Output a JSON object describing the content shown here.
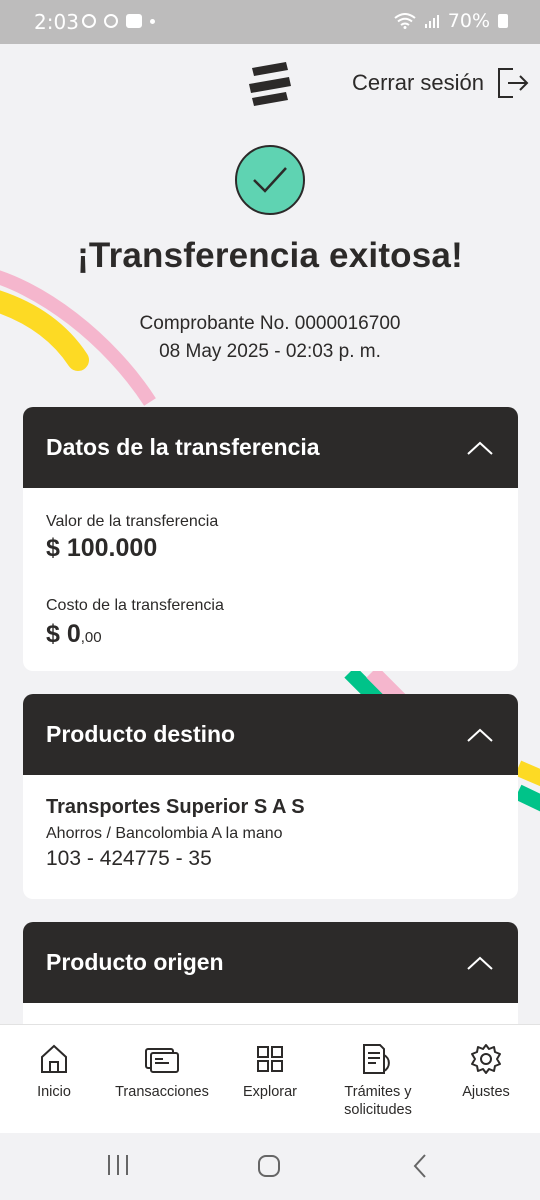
{
  "status_bar": {
    "time": "2:03",
    "battery": "70%"
  },
  "header": {
    "logout_label": "Cerrar sesión"
  },
  "success": {
    "title": "¡Transferencia exitosa!",
    "receipt_line": "Comprobante No. 0000016700",
    "date_line": "08 May 2025 - 02:03 p. m."
  },
  "transfer_card": {
    "title": "Datos de la transferencia",
    "value_label": "Valor de la transferencia",
    "value_amount": "$ 100.000",
    "cost_label": "Costo de la transferencia",
    "cost_amount_main": "$ 0",
    "cost_amount_cents": ",00"
  },
  "destination_card": {
    "title": "Producto destino",
    "name": "Transportes Superior S A S",
    "account_type": "Ahorros / Bancolombia A la mano",
    "account_number": "103 - 424775 - 35"
  },
  "origin_card": {
    "title": "Producto origen"
  },
  "bottom_nav": {
    "items": [
      {
        "label": "Inicio",
        "icon": "home-icon"
      },
      {
        "label": "Transacciones",
        "icon": "cards-icon"
      },
      {
        "label": "Explorar",
        "icon": "grid-icon"
      },
      {
        "label": "Trámites y solicitudes",
        "icon": "document-icon"
      },
      {
        "label": "Ajustes",
        "icon": "gear-icon"
      }
    ]
  },
  "colors": {
    "dark": "#2c2a29",
    "success_green": "#5fd3b2",
    "ribbon_yellow": "#fdda24",
    "ribbon_pink": "#f5b6cd",
    "ribbon_green": "#00c389",
    "background": "#f2f2f4"
  }
}
